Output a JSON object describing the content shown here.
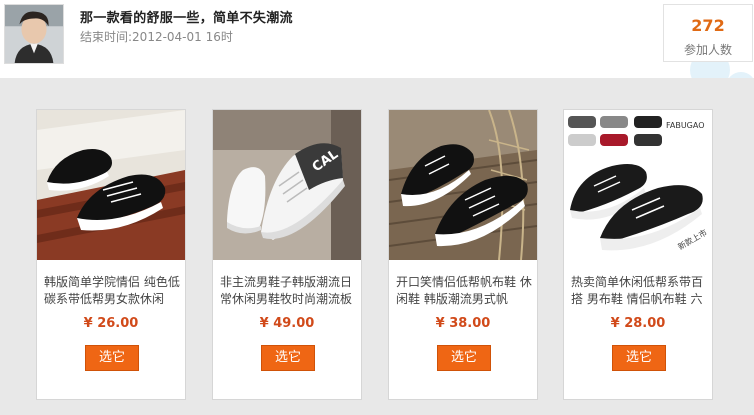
{
  "header": {
    "title": "那一款看的舒服一些，简单不失潮流",
    "end_time": "结束时间:2012-04-01 16时",
    "participants_count": "272",
    "participants_label": "参加人数"
  },
  "products": [
    {
      "name": "韩版简单学院情侣 纯色低碳系带低帮男女款休闲",
      "price": "¥ 26.00",
      "button": "选它"
    },
    {
      "name": "非主流男鞋子韩版潮流日常休闲男鞋牧时尚潮流板",
      "price": "¥ 49.00",
      "button": "选它"
    },
    {
      "name": "开口笑情侣低帮帆布鞋 休闲鞋 韩版潮流男式帆",
      "price": "¥ 38.00",
      "button": "选它"
    },
    {
      "name": "热卖简单休闲低帮系带百搭 男布鞋 情侣帆布鞋 六",
      "price": "¥ 28.00",
      "button": "选它"
    }
  ],
  "image_text": {
    "brand_mark": "CAL",
    "tag": "新款上市",
    "brand_label": "FABUGAO"
  },
  "colors": {
    "accent": "#ef6614",
    "price": "#d14a1a",
    "count": "#e06a14"
  }
}
